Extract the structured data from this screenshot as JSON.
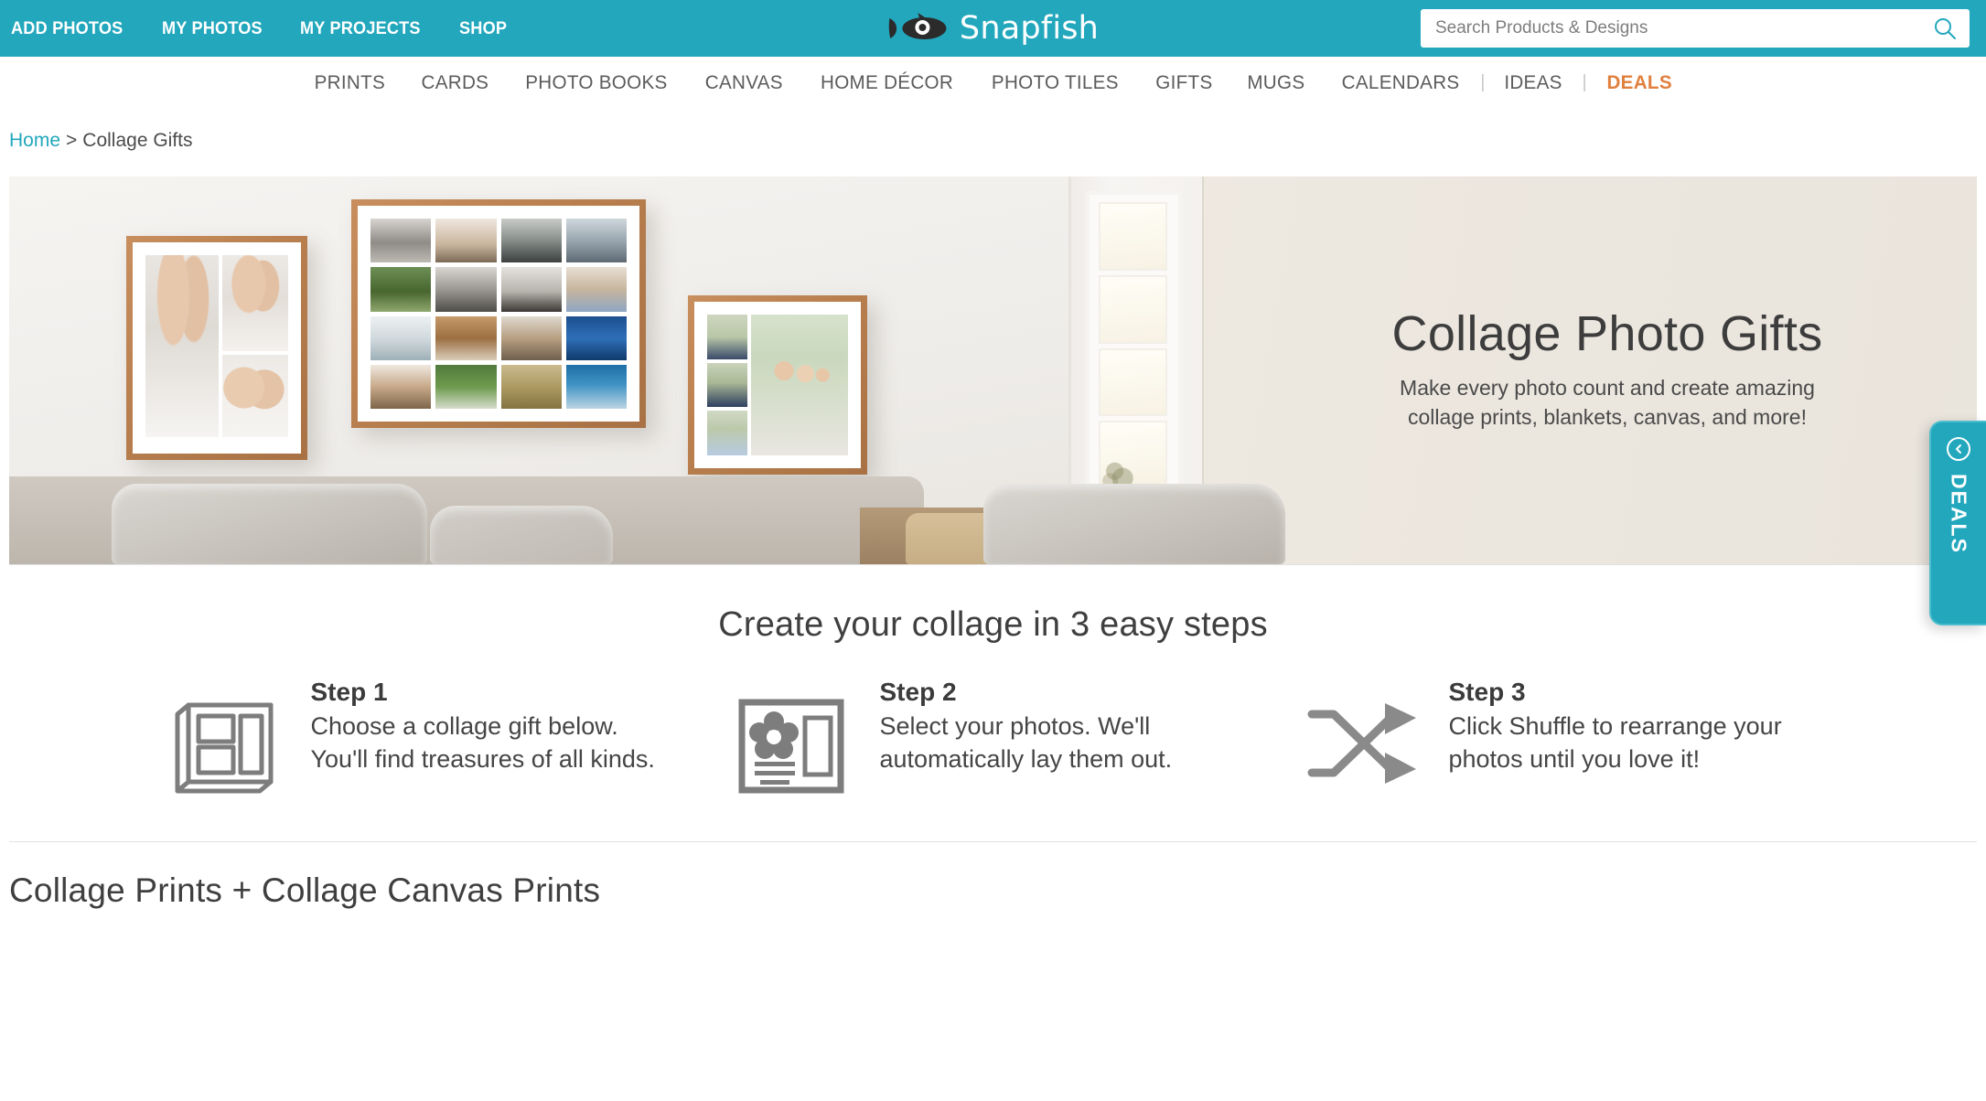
{
  "topbar": {
    "links": [
      {
        "label": "ADD PHOTOS",
        "name": "add-photos"
      },
      {
        "label": "MY PHOTOS",
        "name": "my-photos"
      },
      {
        "label": "MY PROJECTS",
        "name": "my-projects"
      },
      {
        "label": "SHOP",
        "name": "shop"
      }
    ],
    "logo_text": "Snapfish",
    "logo_icon": "fish-icon",
    "background_color": "#22a7bd",
    "search": {
      "placeholder": "Search Products & Designs",
      "value": "",
      "icon": "search-icon"
    }
  },
  "mainnav": {
    "items": [
      {
        "label": "PRINTS"
      },
      {
        "label": "CARDS"
      },
      {
        "label": "PHOTO BOOKS"
      },
      {
        "label": "CANVAS"
      },
      {
        "label": "HOME DÉCOR"
      },
      {
        "label": "PHOTO TILES"
      },
      {
        "label": "GIFTS"
      },
      {
        "label": "MUGS"
      },
      {
        "label": "CALENDARS"
      }
    ],
    "separator": "|",
    "ideas_label": "IDEAS",
    "deals_label": "DEALS",
    "deals_color": "#e0803f",
    "link_color": "#5b5b5b"
  },
  "breadcrumb": {
    "home_label": "Home",
    "separator": ">",
    "current_label": "Collage Gifts",
    "link_color": "#22a7bd"
  },
  "hero": {
    "title": "Collage Photo Gifts",
    "subtitle": "Make every photo count and create amazing collage prints, blankets, canvas, and more!",
    "background_color": "#e9e5df",
    "scene_description": "Living room wall with three wooden-framed photo collages above a grey sofa, French door at right"
  },
  "deals_tab": {
    "label": "DEALS",
    "chevron_icon": "chevron-left-icon",
    "color": "#22a7bd"
  },
  "steps_section": {
    "title": "Create your collage in 3 easy steps",
    "steps": [
      {
        "head": "Step 1",
        "text": "Choose a collage gift below. You'll find treasures of all kinds.",
        "icon": "framed-collage-icon"
      },
      {
        "head": "Step 2",
        "text": "Select your photos. We'll automatically lay them out.",
        "icon": "photo-layout-icon"
      },
      {
        "head": "Step 3",
        "text": "Click Shuffle to rearrange your photos until you love it!",
        "icon": "shuffle-icon"
      }
    ]
  },
  "bottom_section": {
    "title": "Collage Prints + Collage Canvas Prints"
  }
}
